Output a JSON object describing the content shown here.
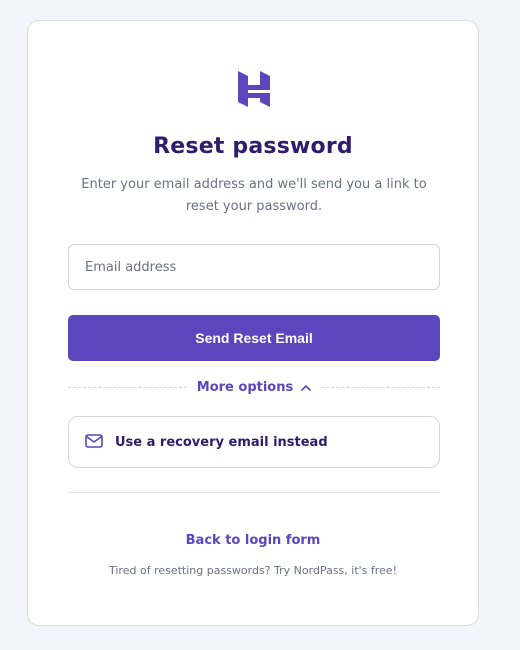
{
  "brand": {
    "logo_icon": "hostinger-logo-icon",
    "accent_color": "#5b46be",
    "heading_color": "#2f1c6a"
  },
  "page": {
    "title": "Reset password",
    "subtitle": "Enter your email address and we'll send you a link to reset your password."
  },
  "form": {
    "email_placeholder": "Email address",
    "email_value": "",
    "submit_label": "Send Reset Email"
  },
  "more_options": {
    "label": "More options",
    "icon": "chevron-up-icon",
    "expanded": true,
    "items": [
      {
        "label": "Use a recovery email instead",
        "icon": "mail-icon"
      }
    ]
  },
  "footer": {
    "back_label": "Back to login form",
    "promo_text": "Tired of resetting passwords? Try NordPass, it's free!"
  }
}
